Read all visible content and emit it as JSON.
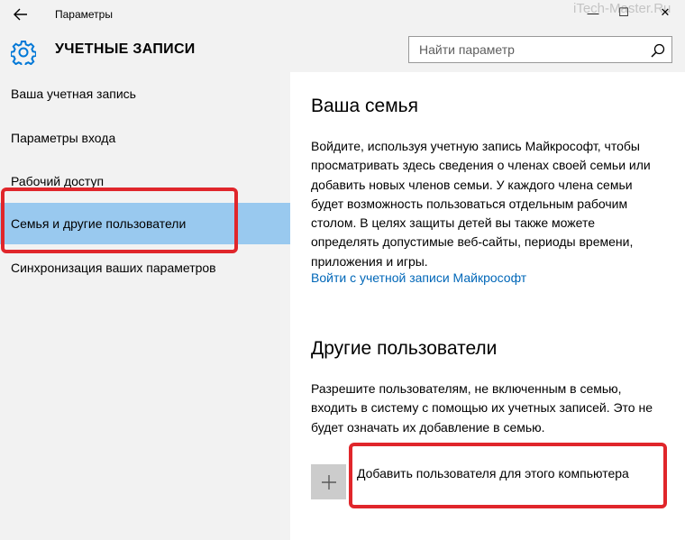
{
  "window": {
    "title": "Параметры",
    "watermark": "iTech-Master.Ru",
    "minimize_glyph": "—",
    "maximize_glyph": "☐",
    "close_glyph": "✕"
  },
  "header": {
    "title": "УЧЕТНЫЕ ЗАПИСИ",
    "icon": "gear-icon",
    "search_placeholder": "Найти параметр"
  },
  "sidebar": {
    "items": [
      {
        "label": "Ваша учетная запись"
      },
      {
        "label": "Параметры входа"
      },
      {
        "label": "Рабочий доступ"
      },
      {
        "label": "Семья и другие пользователи",
        "selected": true
      },
      {
        "label": "Синхронизация ваших параметров"
      }
    ]
  },
  "main": {
    "family_heading": "Ваша семья",
    "family_text": "Войдите, используя учетную запись Майкрософт, чтобы просматривать здесь сведения о членах своей семьи или добавить новых членов семьи. У каждого члена семьи будет возможность пользоваться отдельным рабочим столом. В целях защиты детей вы также можете определять допустимые веб-сайты, периоды времени, приложения и игры.",
    "family_link": "Войти с учетной записи Майкрософт",
    "others_heading": "Другие пользователи",
    "others_text": "Разрешите пользователям, не включенным в семью, входить в систему с помощью их учетных записей. Это не будет означать их добавление в семью.",
    "add_user_label": "Добавить пользователя для этого компьютера"
  },
  "colors": {
    "selected_bg": "#99c9ef",
    "highlight_border": "#e0262b",
    "link": "#0067b8",
    "accent_icon": "#0078d7"
  }
}
